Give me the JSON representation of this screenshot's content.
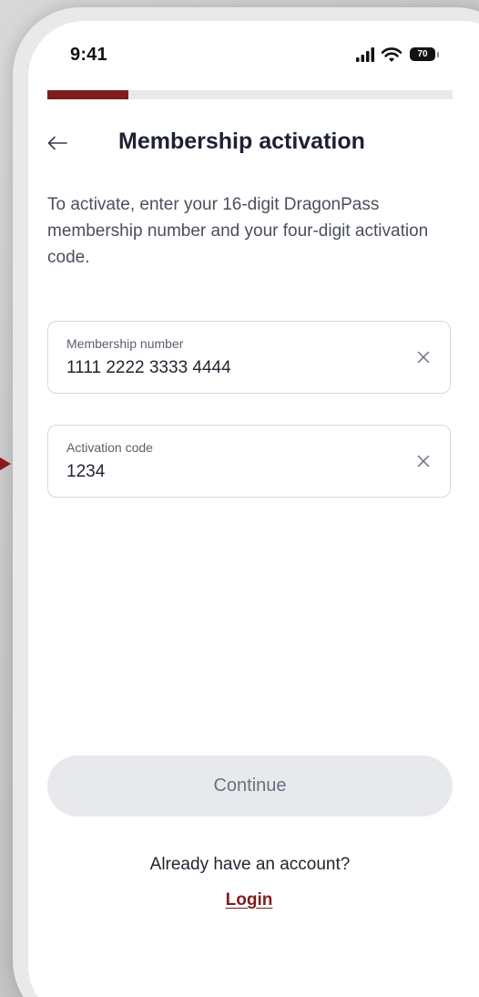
{
  "status_bar": {
    "time": "9:41",
    "battery_level": "70",
    "icons": [
      "signal-icon",
      "wifi-icon",
      "battery-icon"
    ]
  },
  "progress": {
    "fraction": 0.2
  },
  "header": {
    "back_icon": "arrow-left-icon",
    "title": "Membership activation"
  },
  "instructions": "To activate, enter your 16-digit DragonPass membership number and your four-digit activation code.",
  "fields": [
    {
      "label": "Membership number",
      "value": "1111 2222 3333 4444",
      "clear_icon": "close-icon"
    },
    {
      "label": "Activation code",
      "value": "1234",
      "clear_icon": "close-icon"
    }
  ],
  "actions": {
    "continue_label": "Continue",
    "account_prompt": "Already have an account?",
    "login_label": "Login"
  },
  "colors": {
    "accent": "#7f1d1d",
    "button_disabled_bg": "#e8e9ec",
    "progress_track": "#e8e9ec"
  }
}
